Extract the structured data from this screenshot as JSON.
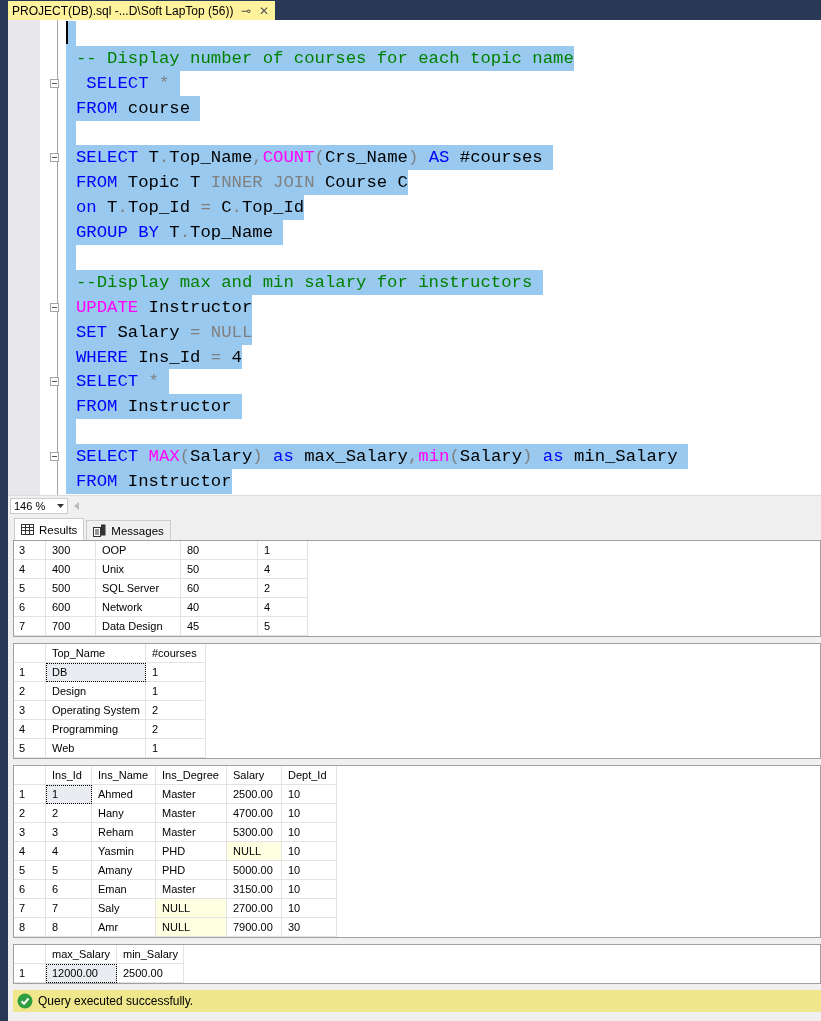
{
  "document_tab": {
    "title": "PROJECT(DB).sql -...D\\Soft LapTop (56))",
    "pin": "⊸",
    "close": "✕"
  },
  "editor": {
    "lines": [
      {
        "fold": false,
        "cursor": true
      },
      {
        "fold": false,
        "tokens": [
          {
            "kind": "comment",
            "text": "-- Display number of courses for each topic name"
          }
        ]
      },
      {
        "fold": true,
        "tokens": [
          {
            "kind": "keyword",
            "text": " SELECT"
          },
          {
            "kind": "operator",
            "text": " * "
          }
        ]
      },
      {
        "fold": false,
        "tokens": [
          {
            "kind": "keyword",
            "text": "FROM"
          },
          {
            "kind": "plain",
            "text": " course "
          }
        ]
      },
      {
        "fold": false
      },
      {
        "fold": true,
        "tokens": [
          {
            "kind": "keyword",
            "text": "SELECT"
          },
          {
            "kind": "plain",
            "text": " T"
          },
          {
            "kind": "operator",
            "text": "."
          },
          {
            "kind": "plain",
            "text": "Top_Name"
          },
          {
            "kind": "operator",
            "text": ","
          },
          {
            "kind": "function",
            "text": "COUNT"
          },
          {
            "kind": "operator",
            "text": "("
          },
          {
            "kind": "plain",
            "text": "Crs_Name"
          },
          {
            "kind": "operator",
            "text": ") "
          },
          {
            "kind": "keyword",
            "text": "AS"
          },
          {
            "kind": "plain",
            "text": " #courses "
          }
        ]
      },
      {
        "fold": false,
        "tokens": [
          {
            "kind": "keyword",
            "text": "FROM"
          },
          {
            "kind": "plain",
            "text": " Topic T "
          },
          {
            "kind": "operator",
            "text": "INNER JOIN"
          },
          {
            "kind": "plain",
            "text": " Course C"
          }
        ]
      },
      {
        "fold": false,
        "tokens": [
          {
            "kind": "keyword",
            "text": "on"
          },
          {
            "kind": "plain",
            "text": " T"
          },
          {
            "kind": "operator",
            "text": "."
          },
          {
            "kind": "plain",
            "text": "Top_Id "
          },
          {
            "kind": "operator",
            "text": "="
          },
          {
            "kind": "plain",
            "text": " C"
          },
          {
            "kind": "operator",
            "text": "."
          },
          {
            "kind": "plain",
            "text": "Top_Id"
          }
        ]
      },
      {
        "fold": false,
        "tokens": [
          {
            "kind": "keyword",
            "text": "GROUP BY"
          },
          {
            "kind": "plain",
            "text": " T"
          },
          {
            "kind": "operator",
            "text": "."
          },
          {
            "kind": "plain",
            "text": "Top_Name "
          }
        ]
      },
      {
        "fold": false
      },
      {
        "fold": false,
        "tokens": [
          {
            "kind": "comment",
            "text": "--Display max and min salary for instructors "
          }
        ]
      },
      {
        "fold": true,
        "tokens": [
          {
            "kind": "function",
            "text": "UPDATE"
          },
          {
            "kind": "plain",
            "text": " Instructor"
          }
        ]
      },
      {
        "fold": false,
        "tokens": [
          {
            "kind": "keyword",
            "text": "SET"
          },
          {
            "kind": "plain",
            "text": " Salary "
          },
          {
            "kind": "operator",
            "text": "= NULL"
          }
        ]
      },
      {
        "fold": false,
        "tokens": [
          {
            "kind": "keyword",
            "text": "WHERE"
          },
          {
            "kind": "plain",
            "text": " Ins_Id "
          },
          {
            "kind": "operator",
            "text": "="
          },
          {
            "kind": "plain",
            "text": " 4"
          }
        ]
      },
      {
        "fold": true,
        "tokens": [
          {
            "kind": "keyword",
            "text": "SELECT"
          },
          {
            "kind": "operator",
            "text": " * "
          }
        ]
      },
      {
        "fold": false,
        "tokens": [
          {
            "kind": "keyword",
            "text": "FROM"
          },
          {
            "kind": "plain",
            "text": " Instructor "
          }
        ]
      },
      {
        "fold": false
      },
      {
        "fold": true,
        "tokens": [
          {
            "kind": "keyword",
            "text": "SELECT"
          },
          {
            "kind": "function",
            "text": " MAX"
          },
          {
            "kind": "operator",
            "text": "("
          },
          {
            "kind": "plain",
            "text": "Salary"
          },
          {
            "kind": "operator",
            "text": ") "
          },
          {
            "kind": "keyword",
            "text": "as"
          },
          {
            "kind": "plain",
            "text": " max_Salary"
          },
          {
            "kind": "operator",
            "text": ","
          },
          {
            "kind": "function",
            "text": "min"
          },
          {
            "kind": "operator",
            "text": "("
          },
          {
            "kind": "plain",
            "text": "Salary"
          },
          {
            "kind": "operator",
            "text": ") "
          },
          {
            "kind": "keyword",
            "text": "as"
          },
          {
            "kind": "plain",
            "text": " min_Salary "
          }
        ]
      },
      {
        "fold": false,
        "tokens": [
          {
            "kind": "keyword",
            "text": "FROM"
          },
          {
            "kind": "plain",
            "text": " Instructor"
          }
        ]
      }
    ]
  },
  "zoom": {
    "value": "146 %"
  },
  "result_tabs": [
    {
      "label": "Results",
      "selected": true,
      "kind": "grid"
    },
    {
      "label": "Messages",
      "selected": false,
      "kind": "messages"
    }
  ],
  "grids": [
    {
      "rows": [
        {
          "num": "3",
          "cells": [
            "300",
            "OOP",
            "80",
            "1"
          ]
        },
        {
          "num": "4",
          "cells": [
            "400",
            "Unix",
            "50",
            "4"
          ]
        },
        {
          "num": "5",
          "cells": [
            "500",
            "SQL Server",
            "60",
            "2"
          ]
        },
        {
          "num": "6",
          "cells": [
            "600",
            "Network",
            "40",
            "4"
          ]
        },
        {
          "num": "7",
          "cells": [
            "700",
            "Data Design",
            "45",
            "5"
          ]
        }
      ]
    },
    {
      "columns": [
        "Top_Name",
        "#courses"
      ],
      "rows": [
        {
          "num": "1",
          "focused": true,
          "cells": [
            "DB",
            "1"
          ]
        },
        {
          "num": "2",
          "focused": false,
          "cells": [
            "Design",
            "1"
          ]
        },
        {
          "num": "3",
          "focused": false,
          "cells": [
            "Operating System",
            "2"
          ]
        },
        {
          "num": "4",
          "focused": false,
          "cells": [
            "Programming",
            "2"
          ]
        },
        {
          "num": "5",
          "focused": false,
          "cells": [
            "Web",
            "1"
          ]
        }
      ]
    },
    {
      "columns": [
        "Ins_Id",
        "Ins_Name",
        "Ins_Degree",
        "Salary",
        "Dept_Id"
      ],
      "rows": [
        {
          "num": "1",
          "focused": true,
          "cells": [
            "1",
            "Ahmed",
            "Master",
            {
              "text": "2500.00",
              "null": false
            },
            "10"
          ]
        },
        {
          "num": "2",
          "focused": false,
          "cells": [
            "2",
            "Hany",
            "Master",
            {
              "text": "4700.00",
              "null": false
            },
            "10"
          ]
        },
        {
          "num": "3",
          "focused": false,
          "cells": [
            "3",
            "Reham",
            "Master",
            {
              "text": "5300.00",
              "null": false
            },
            "10"
          ]
        },
        {
          "num": "4",
          "focused": false,
          "cells": [
            "4",
            "Yasmin",
            "PHD",
            {
              "text": "NULL",
              "null": true
            },
            "10"
          ]
        },
        {
          "num": "5",
          "focused": false,
          "cells": [
            "5",
            "Amany",
            "PHD",
            {
              "text": "5000.00",
              "null": false
            },
            "10"
          ]
        },
        {
          "num": "6",
          "focused": false,
          "cells": [
            "6",
            "Eman",
            "Master",
            {
              "text": "3150.00",
              "null": false
            },
            "10"
          ]
        },
        {
          "num": "7",
          "focused": false,
          "cells": [
            "7",
            "Saly",
            {
              "text": "NULL",
              "null": true
            },
            {
              "text": "2700.00",
              "null": false
            },
            "10"
          ]
        },
        {
          "num": "8",
          "focused": false,
          "cells": [
            "8",
            "Amr",
            {
              "text": "NULL",
              "null": true
            },
            {
              "text": "7900.00",
              "null": false
            },
            "30"
          ]
        }
      ]
    },
    {
      "columns": [
        "max_Salary",
        "min_Salary"
      ],
      "rows": [
        {
          "num": "1",
          "focused": true,
          "cells": [
            "12000.00",
            "2500.00"
          ]
        }
      ]
    }
  ],
  "status_bar": {
    "kind": "success",
    "message": "Query executed successfully."
  }
}
